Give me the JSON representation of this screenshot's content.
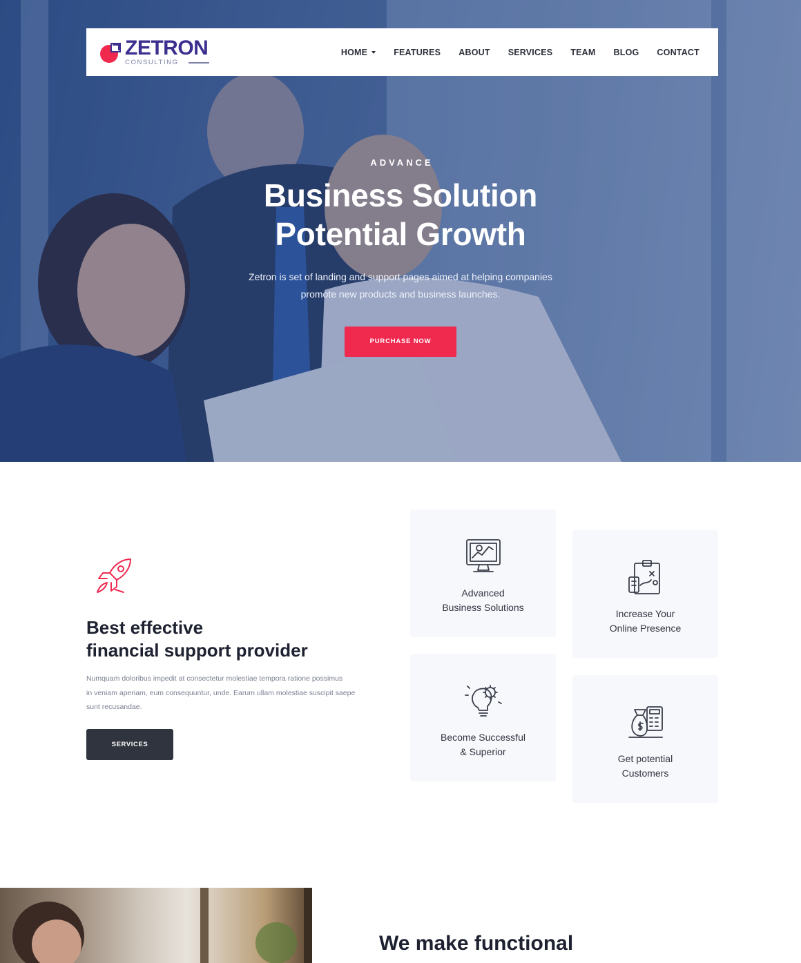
{
  "brand": {
    "name": "ZETRON",
    "sub": "CONSULTING",
    "accent": "#f0294f",
    "primary": "#3b2f8f"
  },
  "nav": [
    {
      "label": "HOME",
      "dropdown": true
    },
    {
      "label": "FEATURES"
    },
    {
      "label": "ABOUT"
    },
    {
      "label": "SERVICES"
    },
    {
      "label": "TEAM"
    },
    {
      "label": "BLOG"
    },
    {
      "label": "CONTACT"
    }
  ],
  "hero": {
    "eyebrow": "ADVANCE",
    "title_line1": "Business Solution",
    "title_line2": "Potential Growth",
    "desc_line1": "Zetron is set of landing and support pages aimed at helping companies",
    "desc_line2": "promote new products and business launches.",
    "cta": "PURCHASE NOW"
  },
  "about": {
    "icon": "rocket-icon",
    "title_line1": "Best effective",
    "title_line2": "financial support provider",
    "desc_line1": "Numquam doloribus impedit at consectetur molestiae tempora ratione possimus",
    "desc_line2": "in veniam aperiam, eum consequuntur, unde. Earum ullam molestiae suscipit saepe",
    "desc_line3": "sunt recusandae.",
    "button": "SERVICES"
  },
  "cards": [
    {
      "icon": "monitor-chart-icon",
      "line1": "Advanced",
      "line2": "Business Solutions"
    },
    {
      "icon": "strategy-board-icon",
      "line1": "Increase Your",
      "line2": "Online Presence"
    },
    {
      "icon": "lightbulb-gear-icon",
      "line1": "Become Successful",
      "line2": "& Superior"
    },
    {
      "icon": "money-calculator-icon",
      "line1": "Get potential",
      "line2": "Customers"
    }
  ],
  "bottom": {
    "title_line1": "We make functional"
  }
}
